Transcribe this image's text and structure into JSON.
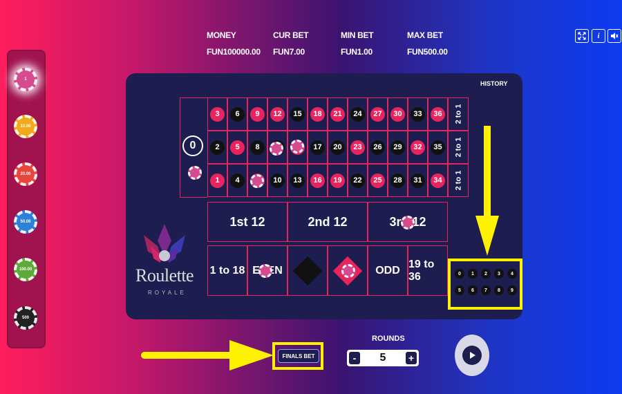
{
  "stats": [
    {
      "label": "MONEY",
      "value": "FUN100000.00"
    },
    {
      "label": "CUR BET",
      "value": "FUN7.00"
    },
    {
      "label": "MIN BET",
      "value": "FUN1.00"
    },
    {
      "label": "MAX BET",
      "value": "FUN500.00"
    }
  ],
  "icons": [
    "fullscreen-icon",
    "info-icon",
    "sound-icon"
  ],
  "info_glyph": "i",
  "chips": [
    {
      "label": "1",
      "color": "#d64b8e"
    },
    {
      "label": "10.00",
      "color": "#f2a91b"
    },
    {
      "label": "20.00",
      "color": "#e8453c"
    },
    {
      "label": "50.00",
      "color": "#2e7fd8"
    },
    {
      "label": "100.00",
      "color": "#5fa83a"
    },
    {
      "label": "500",
      "color": "#222222"
    }
  ],
  "history_label": "HISTORY",
  "zero": "0",
  "rows": [
    [
      {
        "n": "3",
        "c": "red"
      },
      {
        "n": "6",
        "c": "black"
      },
      {
        "n": "9",
        "c": "red"
      },
      {
        "n": "12",
        "c": "red"
      },
      {
        "n": "15",
        "c": "black"
      },
      {
        "n": "18",
        "c": "red"
      },
      {
        "n": "21",
        "c": "red"
      },
      {
        "n": "24",
        "c": "black"
      },
      {
        "n": "27",
        "c": "red"
      },
      {
        "n": "30",
        "c": "red"
      },
      {
        "n": "33",
        "c": "black"
      },
      {
        "n": "36",
        "c": "red"
      }
    ],
    [
      {
        "n": "2",
        "c": "black"
      },
      {
        "n": "5",
        "c": "red"
      },
      {
        "n": "8",
        "c": "black"
      },
      {
        "n": "11",
        "c": "black"
      },
      {
        "n": "14",
        "c": "red"
      },
      {
        "n": "17",
        "c": "black"
      },
      {
        "n": "20",
        "c": "black"
      },
      {
        "n": "23",
        "c": "red"
      },
      {
        "n": "26",
        "c": "black"
      },
      {
        "n": "29",
        "c": "black"
      },
      {
        "n": "32",
        "c": "red"
      },
      {
        "n": "35",
        "c": "black"
      }
    ],
    [
      {
        "n": "1",
        "c": "red"
      },
      {
        "n": "4",
        "c": "black"
      },
      {
        "n": "7",
        "c": "red"
      },
      {
        "n": "10",
        "c": "black"
      },
      {
        "n": "13",
        "c": "black"
      },
      {
        "n": "16",
        "c": "red"
      },
      {
        "n": "19",
        "c": "red"
      },
      {
        "n": "22",
        "c": "black"
      },
      {
        "n": "25",
        "c": "red"
      },
      {
        "n": "28",
        "c": "black"
      },
      {
        "n": "31",
        "c": "black"
      },
      {
        "n": "34",
        "c": "red"
      }
    ]
  ],
  "column_bets": [
    "2 to 1",
    "2 to 1",
    "2 to 1"
  ],
  "dozens": [
    "1st 12",
    "2nd 12",
    "3rd 12"
  ],
  "even_bets": [
    "1 to 18",
    "EVEN",
    "",
    "",
    "ODD",
    "19 to 36"
  ],
  "logo_title": "Roulette",
  "logo_subtitle": "ROYALE",
  "finals_bet_label": "FINALS BET",
  "finals_digits": [
    "0",
    "1",
    "2",
    "3",
    "4",
    "5",
    "6",
    "7",
    "8",
    "9"
  ],
  "rounds_label": "ROUNDS",
  "rounds_value": "5",
  "minus_label": "-",
  "plus_label": "+",
  "colors": {
    "red": "#e8245f",
    "black": "#111111",
    "panel": "#1e1d50",
    "highlight": "#fff200"
  }
}
